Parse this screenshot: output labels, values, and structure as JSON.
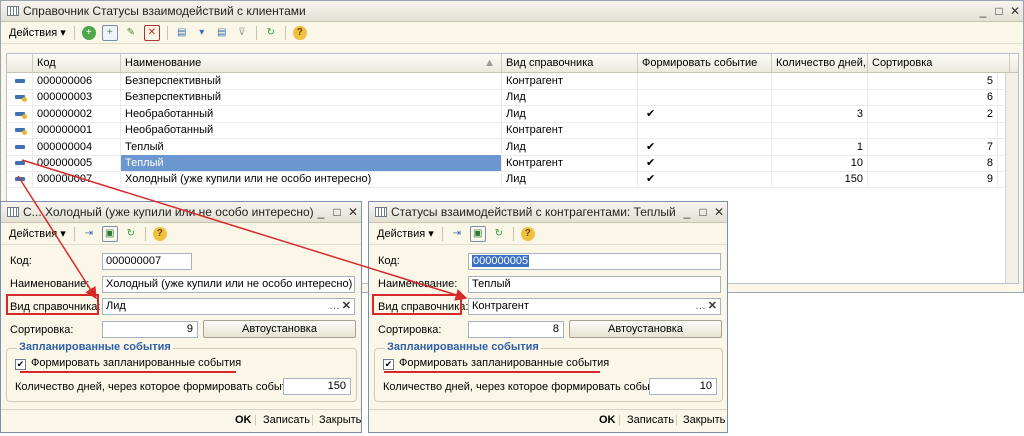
{
  "main_window": {
    "title": "Справочник Статусы взаимодействий с клиентами",
    "toolbar": {
      "actions_label": "Действия"
    },
    "columns": [
      "Код",
      "Наименование",
      "Вид справочника",
      "Формировать событие",
      "Количество дней,...",
      "Сортировка"
    ],
    "rows": [
      {
        "code": "000000006",
        "name": "Безперспективный",
        "kind": "Контрагент",
        "event": "",
        "days": "",
        "sort": "5",
        "icon": "plain"
      },
      {
        "code": "000000003",
        "name": "Безперспективный",
        "kind": "Лид",
        "event": "",
        "days": "",
        "sort": "6",
        "icon": "yellow"
      },
      {
        "code": "000000002",
        "name": "Необработанный",
        "kind": "Лид",
        "event": "✔",
        "days": "3",
        "sort": "2",
        "icon": "yellow"
      },
      {
        "code": "000000001",
        "name": "Необработанный",
        "kind": "Контрагент",
        "event": "",
        "days": "",
        "sort": "",
        "icon": "yellow"
      },
      {
        "code": "000000004",
        "name": "Теплый",
        "kind": "Лид",
        "event": "✔",
        "days": "1",
        "sort": "7",
        "icon": "plain"
      },
      {
        "code": "000000005",
        "name": "Теплый",
        "kind": "Контрагент",
        "event": "✔",
        "days": "10",
        "sort": "8",
        "icon": "plain"
      },
      {
        "code": "000000007",
        "name": "Холодный (уже купили или не особо интересно)",
        "kind": "Лид",
        "event": "✔",
        "days": "150",
        "sort": "9",
        "icon": "plain"
      }
    ]
  },
  "form_left": {
    "title": "С... Холодный (уже купили или не особо интересно)",
    "actions_label": "Действия",
    "code_label": "Код:",
    "code_value": "000000007",
    "name_label": "Наименование:",
    "name_value": "Холодный (уже купили или не особо интересно)",
    "kind_label": "Вид справочника:",
    "kind_value": "Лид",
    "sort_label": "Сортировка:",
    "sort_value": "9",
    "auto_button": "Автоустановка",
    "group_title": "Запланированные события",
    "checkbox_label": "Формировать запланированные события",
    "days_label": "Количество дней, через которое формировать событие:",
    "days_value": "150",
    "ok": "OK",
    "save": "Записать",
    "close": "Закрыть"
  },
  "form_right": {
    "title": "Статусы взаимодействий с контрагентами: Теплый",
    "actions_label": "Действия",
    "code_label": "Код:",
    "code_value": "000000005",
    "name_label": "Наименование:",
    "name_value": "Теплый",
    "kind_label": "Вид справочника:",
    "kind_value": "Контрагент",
    "sort_label": "Сортировка:",
    "sort_value": "8",
    "auto_button": "Автоустановка",
    "group_title": "Запланированные события",
    "checkbox_label": "Формировать запланированные события",
    "days_label": "Количество дней, через которое формировать событие:",
    "days_value": "10",
    "ok": "OK",
    "save": "Записать",
    "close": "Закрыть"
  },
  "colors": {
    "selection": "#6b96d0",
    "annotation": "#d62a2a",
    "group_title": "#2e5fa8"
  }
}
